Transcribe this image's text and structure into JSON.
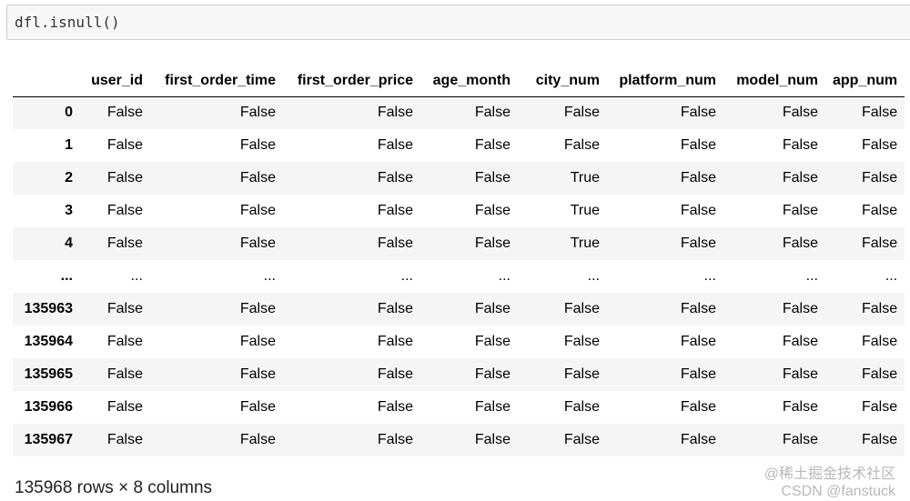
{
  "input": {
    "code": "dfl.isnull()"
  },
  "table": {
    "columns": [
      "",
      "user_id",
      "first_order_time",
      "first_order_price",
      "age_month",
      "city_num",
      "platform_num",
      "model_num",
      "app_num"
    ],
    "rows": [
      {
        "index": "0",
        "values": [
          "False",
          "False",
          "False",
          "False",
          "False",
          "False",
          "False",
          "False"
        ]
      },
      {
        "index": "1",
        "values": [
          "False",
          "False",
          "False",
          "False",
          "False",
          "False",
          "False",
          "False"
        ]
      },
      {
        "index": "2",
        "values": [
          "False",
          "False",
          "False",
          "False",
          "True",
          "False",
          "False",
          "False"
        ]
      },
      {
        "index": "3",
        "values": [
          "False",
          "False",
          "False",
          "False",
          "True",
          "False",
          "False",
          "False"
        ]
      },
      {
        "index": "4",
        "values": [
          "False",
          "False",
          "False",
          "False",
          "True",
          "False",
          "False",
          "False"
        ]
      },
      {
        "index": "...",
        "values": [
          "...",
          "...",
          "...",
          "...",
          "...",
          "...",
          "...",
          "..."
        ]
      },
      {
        "index": "135963",
        "values": [
          "False",
          "False",
          "False",
          "False",
          "False",
          "False",
          "False",
          "False"
        ]
      },
      {
        "index": "135964",
        "values": [
          "False",
          "False",
          "False",
          "False",
          "False",
          "False",
          "False",
          "False"
        ]
      },
      {
        "index": "135965",
        "values": [
          "False",
          "False",
          "False",
          "False",
          "False",
          "False",
          "False",
          "False"
        ]
      },
      {
        "index": "135966",
        "values": [
          "False",
          "False",
          "False",
          "False",
          "False",
          "False",
          "False",
          "False"
        ]
      },
      {
        "index": "135967",
        "values": [
          "False",
          "False",
          "False",
          "False",
          "False",
          "False",
          "False",
          "False"
        ]
      }
    ]
  },
  "dimensions": "135968 rows × 8 columns",
  "watermark": {
    "line1": "@稀土掘金技术社区",
    "line2": "CSDN @fanstuck"
  }
}
